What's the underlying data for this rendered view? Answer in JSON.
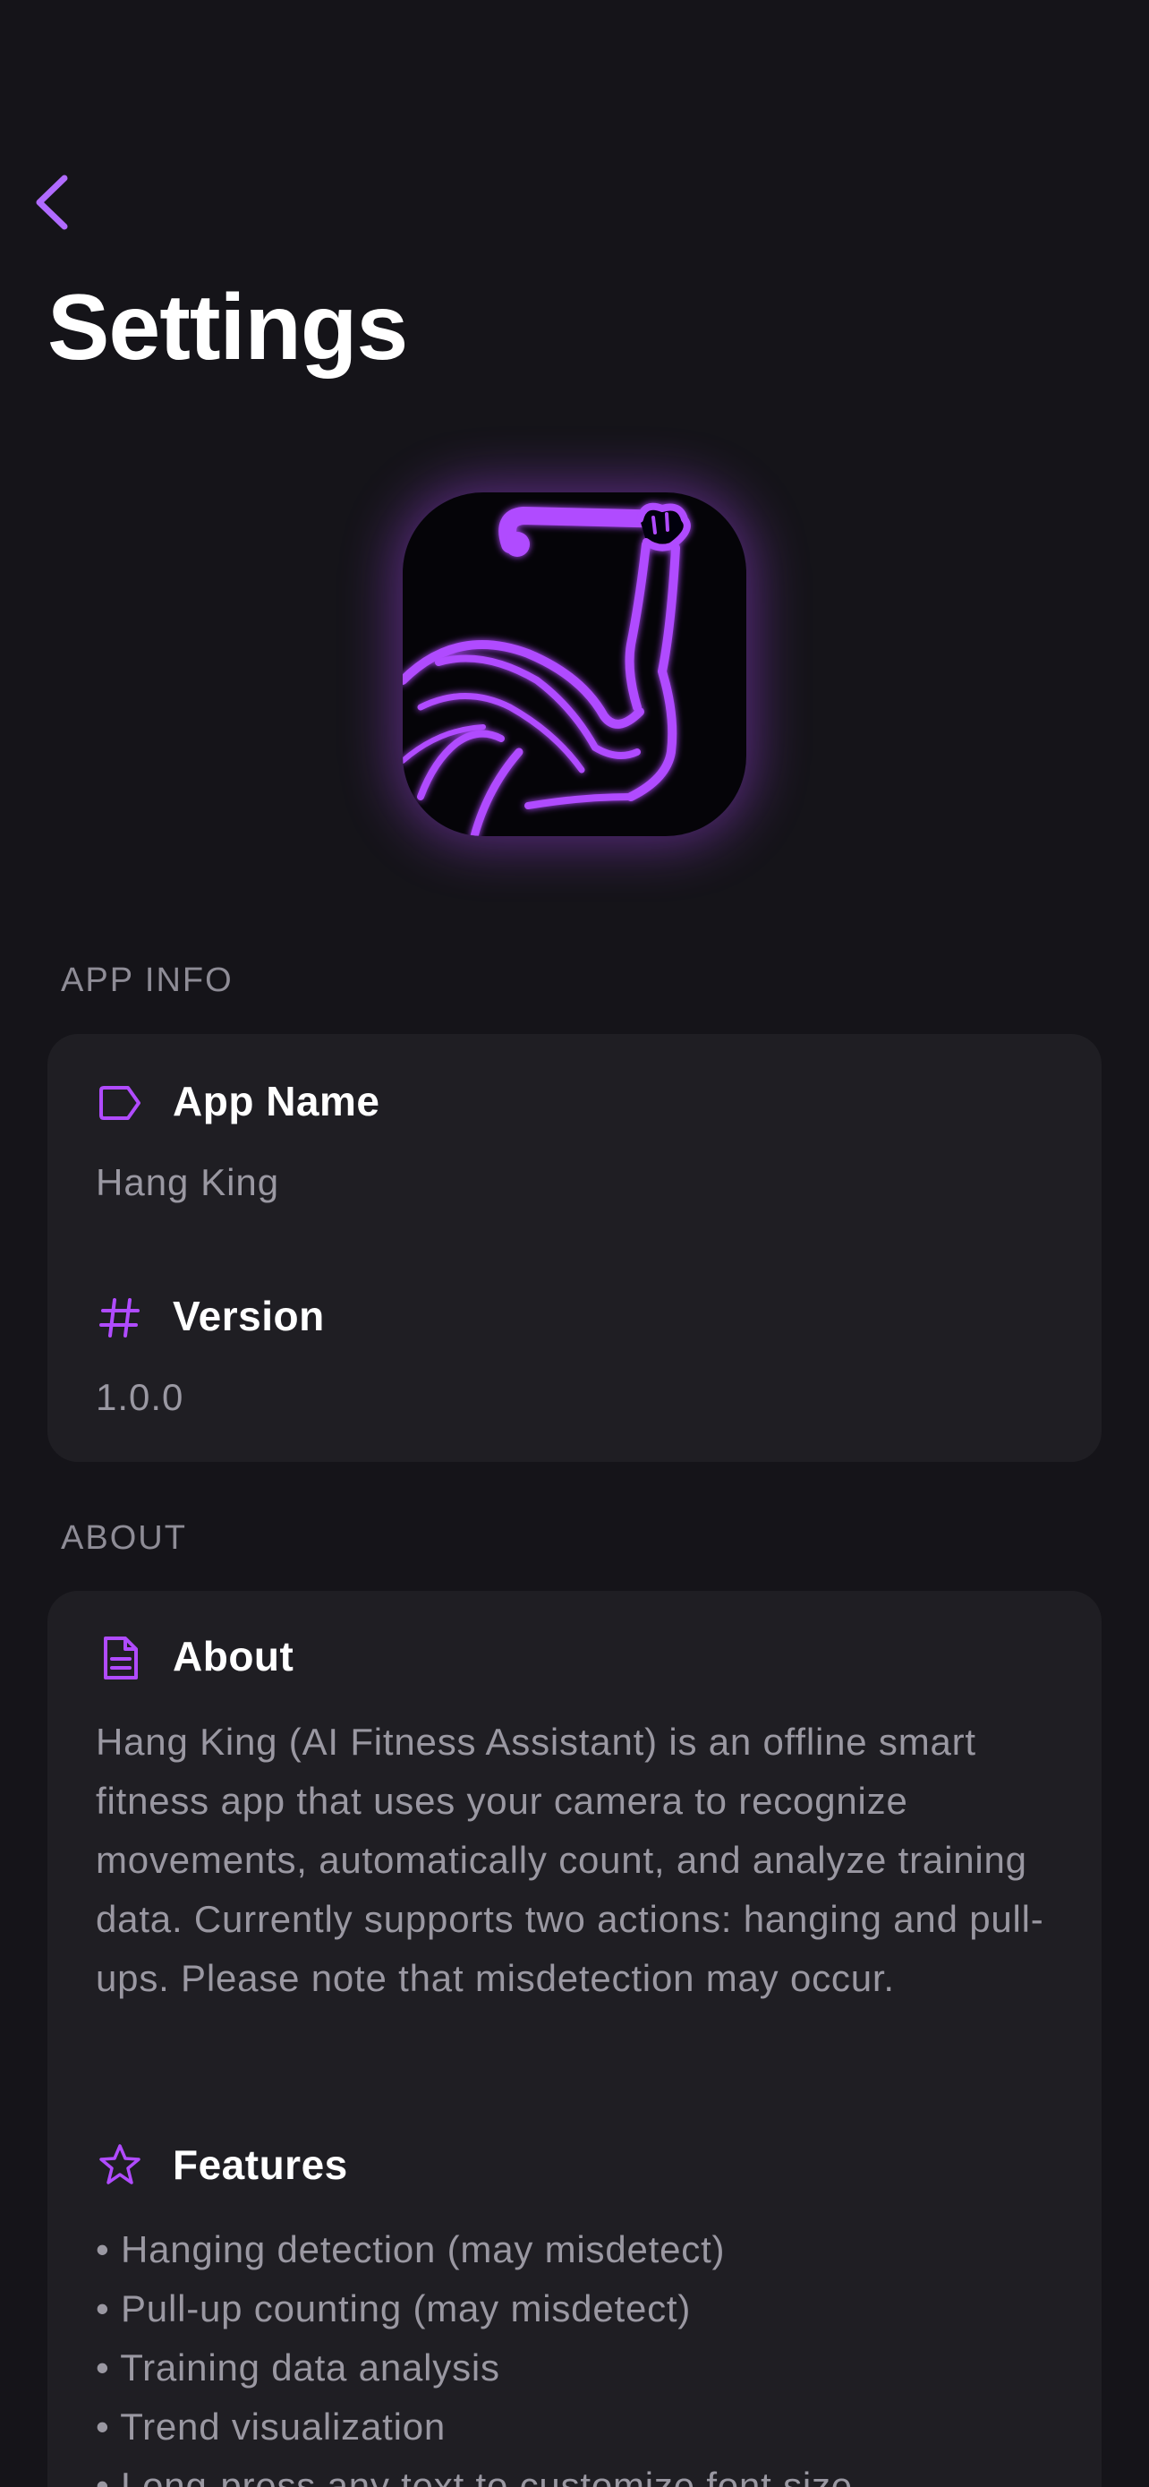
{
  "header": {
    "back_icon": "chevron-left-icon",
    "title": "Settings"
  },
  "logo": {
    "icon": "flexed-arm-hanging-bar-icon",
    "accent": "#b04bff"
  },
  "app_info": {
    "section_label": "APP INFO",
    "rows": [
      {
        "icon": "tag-icon",
        "title": "App Name",
        "value": "Hang King"
      },
      {
        "icon": "hash-icon",
        "title": "Version",
        "value": "1.0.0"
      }
    ]
  },
  "about": {
    "section_label": "ABOUT",
    "about_row": {
      "icon": "document-icon",
      "title": "About",
      "text": "Hang King (AI Fitness Assistant) is an offline smart fitness app that uses your camera to recognize movements, automatically count, and analyze training data. Currently supports two actions: hanging and pull-ups. Please note that misdetection may occur."
    },
    "features_row": {
      "icon": "star-icon",
      "title": "Features",
      "items": [
        "• Hanging detection (may misdetect)",
        "• Pull-up counting (may misdetect)",
        "• Training data analysis",
        "• Trend visualization",
        "• Long-press any text to customize font size"
      ]
    }
  },
  "colors": {
    "background": "#151419",
    "card": "#1f1e23",
    "accent": "#b04bff",
    "secondary_text": "#9a98a2",
    "section_label": "#8e8c96"
  }
}
